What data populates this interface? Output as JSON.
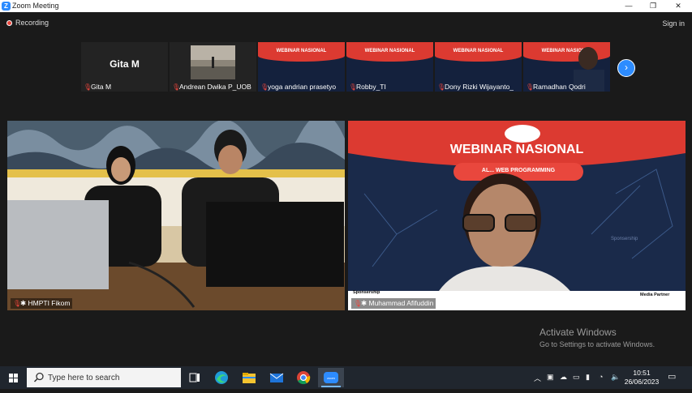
{
  "window": {
    "title": "Zoom Meeting",
    "minimize": "—",
    "restore": "❐",
    "close": "✕"
  },
  "toolbar": {
    "recording_label": "Recording",
    "sign_in_label": "Sign in"
  },
  "participants": [
    {
      "name": "Gita M",
      "avatar_text": "Gita M",
      "muted": true
    },
    {
      "name": "Andrean Dwika P_UOB",
      "muted": true
    },
    {
      "name": "yoga andrian prasetyo",
      "muted": true
    },
    {
      "name": "Robby_TI",
      "muted": true
    },
    {
      "name": "Dony Rizki Wijayanto_",
      "muted": true
    },
    {
      "name": "Ramadhan Qodri",
      "muted": true
    }
  ],
  "gallery": {
    "next_page_icon": "chevron-right-icon"
  },
  "main_videos": [
    {
      "name": "HMPTI Fikom",
      "muted": true
    },
    {
      "name": "Muhammad Afifuddin",
      "muted": true
    }
  ],
  "slide": {
    "title": "WEBINAR NASIONAL",
    "subtitle": "AL... WEB PROGRAMMING",
    "sponsorship_label": "Sponsership",
    "media_partner_label": "Media Partner",
    "watermark": "Sponsership"
  },
  "watermark": {
    "line1": "Activate Windows",
    "line2": "Go to Settings to activate Windows."
  },
  "taskbar": {
    "search_placeholder": "Type here to search",
    "time": "10:51",
    "date": "26/06/2023",
    "colors": {
      "bg": "#20262e",
      "zoom_blue": "#2d8cff",
      "rec_red": "#e8453c",
      "slide_red": "#dc3a31"
    }
  }
}
